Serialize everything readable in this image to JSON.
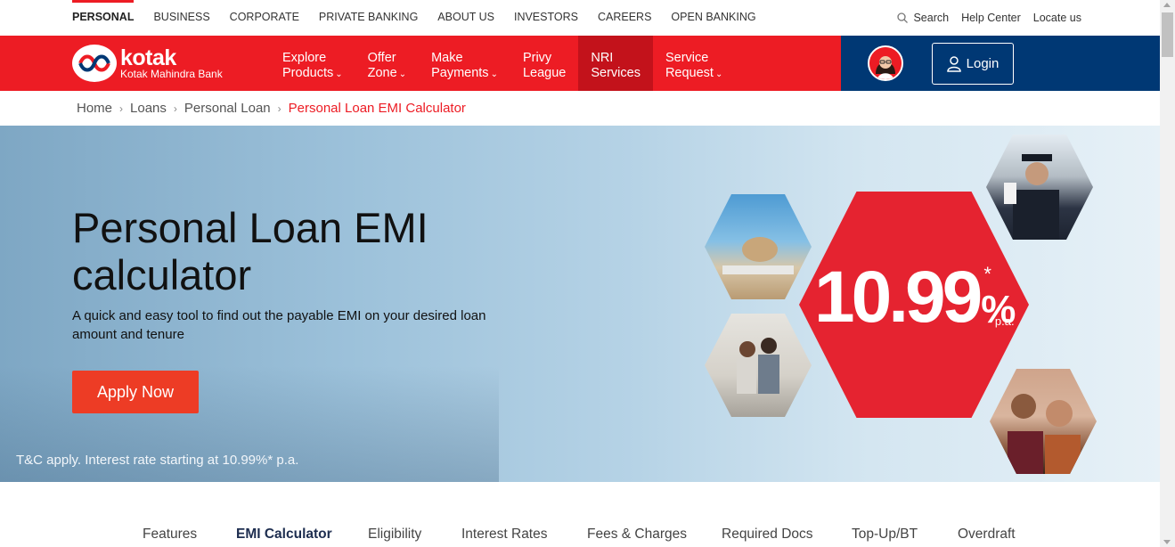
{
  "top_nav": {
    "items": [
      "PERSONAL",
      "BUSINESS",
      "CORPORATE",
      "PRIVATE BANKING",
      "ABOUT US",
      "INVESTORS",
      "CAREERS",
      "OPEN BANKING"
    ],
    "active": "PERSONAL"
  },
  "utility": {
    "search": "Search",
    "help": "Help Center",
    "locate": "Locate us"
  },
  "logo": {
    "brand": "kotak",
    "sub": "Kotak Mahindra Bank"
  },
  "main_menu": [
    {
      "line1": "Explore",
      "line2": "Products",
      "caret": true
    },
    {
      "line1": "Offer",
      "line2": "Zone",
      "caret": true
    },
    {
      "line1": "Make",
      "line2": "Payments",
      "caret": true
    },
    {
      "line1": "Privy",
      "line2": "League",
      "caret": false
    },
    {
      "line1": "NRI",
      "line2": "Services",
      "caret": false
    },
    {
      "line1": "Service",
      "line2": "Request",
      "caret": true
    }
  ],
  "account": {
    "login_label": "Login"
  },
  "breadcrumb": [
    "Home",
    "Loans",
    "Personal Loan",
    "Personal Loan EMI Calculator"
  ],
  "hero": {
    "title": "Personal Loan EMI calculator",
    "description": "A quick and easy tool to find out the payable EMI on your desired loan amount and tenure",
    "cta": "Apply Now",
    "tnc": "T&C apply. Interest rate starting at 10.99%* p.a.",
    "rate_number": "10.99",
    "rate_percent": "%",
    "rate_star": "*",
    "rate_pa": "p.a."
  },
  "tabs": {
    "items": [
      "Features",
      "EMI Calculator",
      "Eligibility",
      "Interest Rates",
      "Fees & Charges",
      "Required Docs",
      "Top-Up/BT",
      "Overdraft"
    ],
    "active": "EMI Calculator"
  },
  "colors": {
    "brand_red": "#ed1c24",
    "navy": "#003874",
    "cta": "#ed3c25"
  }
}
